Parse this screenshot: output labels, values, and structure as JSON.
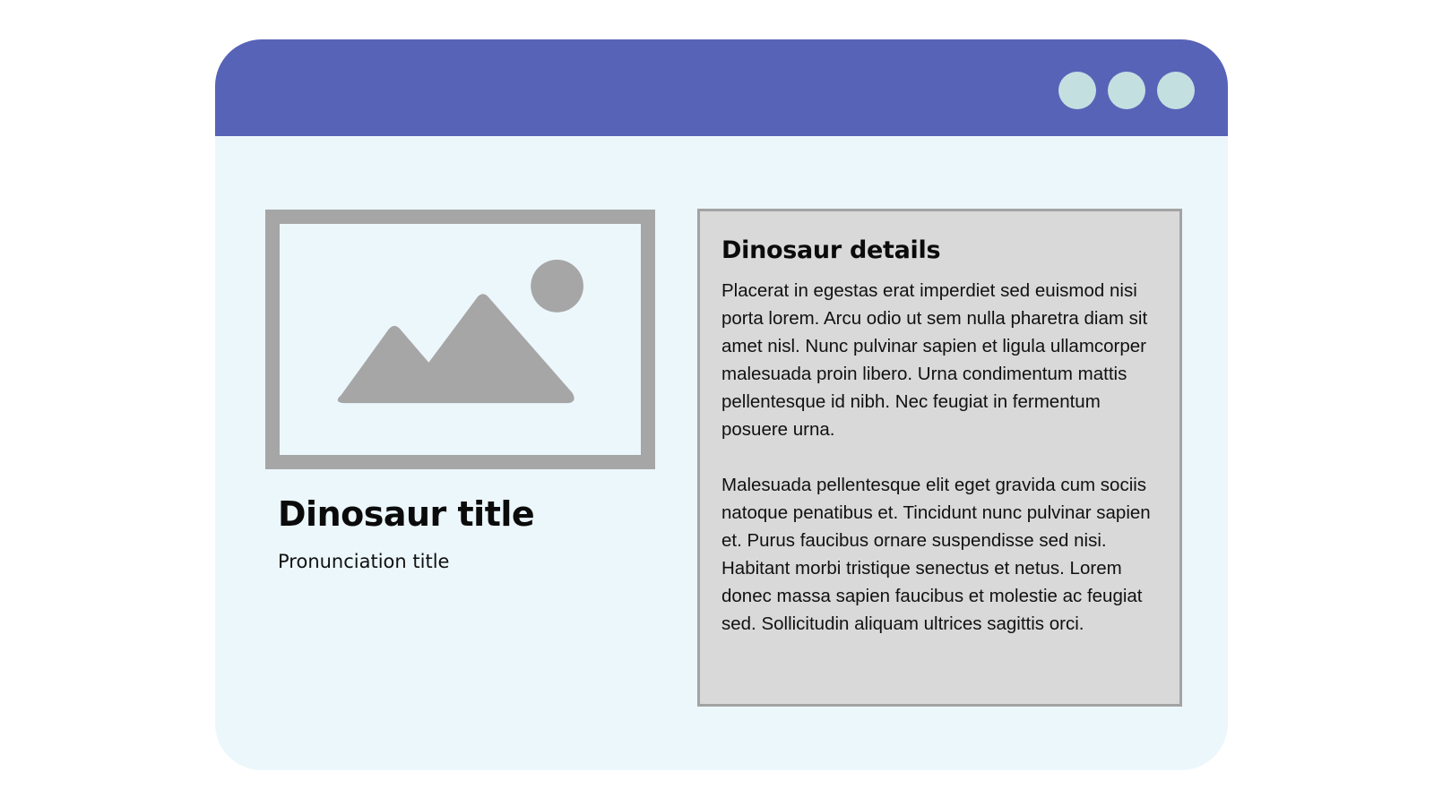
{
  "window": {
    "titlebar_color": "#5763b7",
    "body_color": "#ecf7fc",
    "controls": [
      {
        "name": "window-control-1",
        "color": "#c4dfe0"
      },
      {
        "name": "window-control-2",
        "color": "#c4dfe0"
      },
      {
        "name": "window-control-3",
        "color": "#c4dfe0"
      }
    ]
  },
  "image": {
    "icon": "image-placeholder-icon",
    "color": "#a6a6a6"
  },
  "dinosaur": {
    "title": "Dinosaur title",
    "pronunciation": "Pronunciation title"
  },
  "details": {
    "heading": "Dinosaur details",
    "paragraphs": [
      "Placerat in egestas erat imperdiet sed euismod nisi porta lorem. Arcu odio ut sem nulla pharetra diam sit amet nisl. Nunc pulvinar sapien et ligula ullamcorper malesuada proin libero. Urna condimentum mattis pellentesque id nibh. Nec feugiat in fermentum posuere urna.",
      "Malesuada pellentesque elit eget gravida cum sociis natoque penatibus et. Tincidunt nunc pulvinar sapien et. Purus faucibus ornare suspendisse sed nisi. Habitant morbi tristique senectus et netus. Lorem donec massa sapien faucibus et molestie ac feugiat sed. Sollicitudin aliquam ultrices sagittis orci."
    ],
    "background": "#d9d9d9",
    "border": "#a3a3a3"
  }
}
